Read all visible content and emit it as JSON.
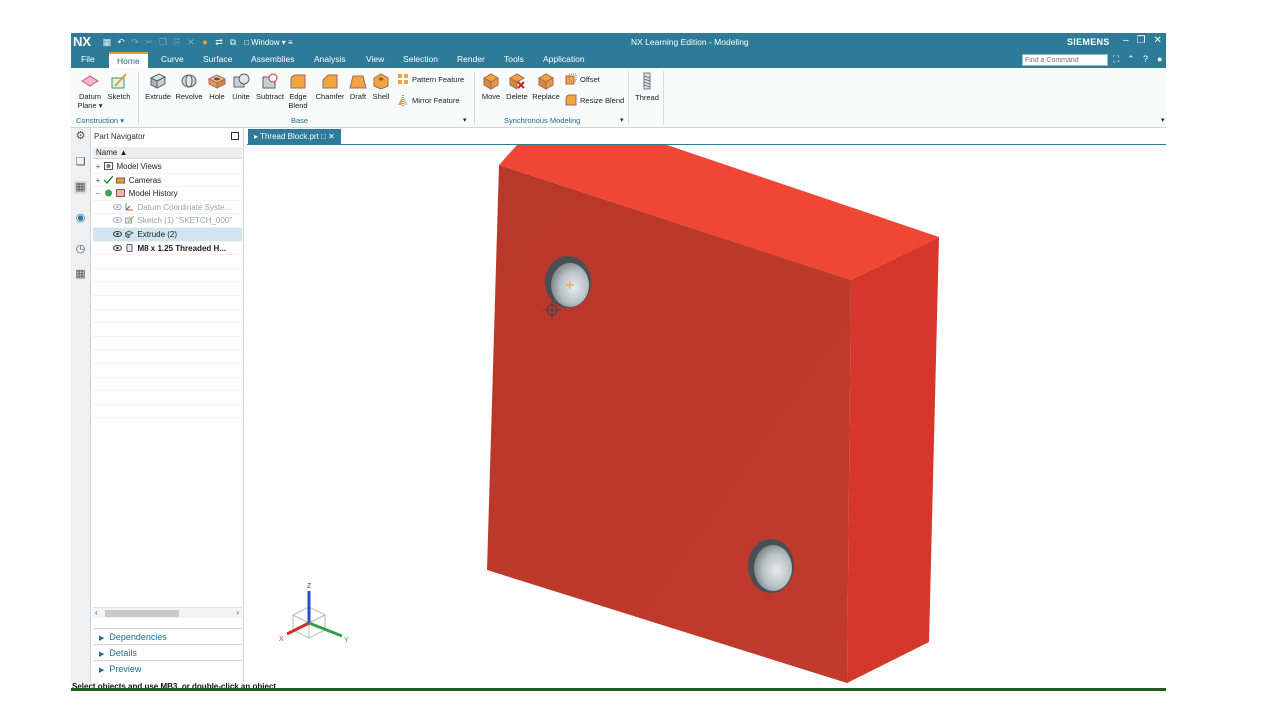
{
  "app": {
    "logo": "NX",
    "title": "NX Learning Edition - Modeling",
    "brand": "SIEMENS",
    "window_menu": "Window"
  },
  "menu": {
    "tabs": [
      "File",
      "Home",
      "Curve",
      "Surface",
      "Assemblies",
      "Analysis",
      "View",
      "Selection",
      "Render",
      "Tools",
      "Application"
    ],
    "active_tab": "Home",
    "find_placeholder": "Find a Command"
  },
  "ribbon": {
    "construction": {
      "label": "Construction",
      "buttons": [
        {
          "label_line1": "Datum",
          "label_line2": "Plane",
          "icon": "datum-plane-icon"
        },
        {
          "label_line1": "Sketch",
          "label_line2": "",
          "icon": "sketch-icon"
        }
      ]
    },
    "base": {
      "label": "Base",
      "buttons": [
        {
          "label_line1": "Extrude",
          "label_line2": "",
          "icon": "extrude-icon"
        },
        {
          "label_line1": "Revolve",
          "label_line2": "",
          "icon": "revolve-icon"
        },
        {
          "label_line1": "Hole",
          "label_line2": "",
          "icon": "hole-icon"
        },
        {
          "label_line1": "Unite",
          "label_line2": "",
          "icon": "unite-icon"
        },
        {
          "label_line1": "Subtract",
          "label_line2": "",
          "icon": "subtract-icon"
        },
        {
          "label_line1": "Edge",
          "label_line2": "Blend",
          "icon": "edge-blend-icon"
        },
        {
          "label_line1": "Chamfer",
          "label_line2": "",
          "icon": "chamfer-icon"
        },
        {
          "label_line1": "Draft",
          "label_line2": "",
          "icon": "draft-icon"
        },
        {
          "label_line1": "Shell",
          "label_line2": "",
          "icon": "shell-icon"
        }
      ],
      "small": [
        {
          "label": "Pattern Feature",
          "icon": "pattern-feature-icon"
        },
        {
          "label": "Mirror Feature",
          "icon": "mirror-feature-icon"
        }
      ]
    },
    "sync": {
      "label": "Synchronous Modeling",
      "buttons": [
        {
          "label_line1": "Move",
          "icon": "move-face-icon"
        },
        {
          "label_line1": "Delete",
          "icon": "delete-face-icon"
        },
        {
          "label_line1": "Replace",
          "icon": "replace-face-icon"
        }
      ],
      "small": [
        {
          "label": "Offset",
          "icon": "offset-icon"
        },
        {
          "label": "Resize Blend",
          "icon": "resize-blend-icon"
        }
      ]
    },
    "thread": {
      "label": "Thread",
      "icon": "thread-icon"
    }
  },
  "navigator": {
    "title": "Part Navigator",
    "column_header": "Name",
    "rows": [
      {
        "text": "Model Views",
        "expander": "+",
        "icon": "model-views-icon",
        "indent": 0,
        "state": "normal"
      },
      {
        "text": "Cameras",
        "expander": "+",
        "icon": "cameras-icon",
        "indent": 0,
        "state": "normal"
      },
      {
        "text": "Model History",
        "expander": "−",
        "icon": "model-history-icon",
        "indent": 0,
        "state": "normal"
      },
      {
        "text": "Datum Coordinate Syste...",
        "expander": "",
        "icon": "datum-csys-icon",
        "indent": 1,
        "state": "dim"
      },
      {
        "text": "Sketch (1) \"SKETCH_000\"",
        "expander": "",
        "icon": "sketch-feature-icon",
        "indent": 1,
        "state": "dim"
      },
      {
        "text": "Extrude (2)",
        "expander": "",
        "icon": "extrude-feature-icon",
        "indent": 1,
        "state": "selected"
      },
      {
        "text": "M8 x 1.25 Threaded H...",
        "expander": "",
        "icon": "hole-feature-icon",
        "indent": 1,
        "state": "bold"
      }
    ],
    "panels": [
      "Dependencies",
      "Details",
      "Preview"
    ]
  },
  "graphics": {
    "tab_label": "Thread Block.prt",
    "triad": {
      "x": "X",
      "y": "Y",
      "z": "Z"
    }
  },
  "status": {
    "text": "Select objects and use MB3, or double-click an object"
  },
  "colors": {
    "title_bar": "#2d7a99",
    "part_face_front": "#b8382a",
    "part_face_top": "#f04634",
    "part_face_side": "#d6372a",
    "accent": "#e89a2a"
  }
}
